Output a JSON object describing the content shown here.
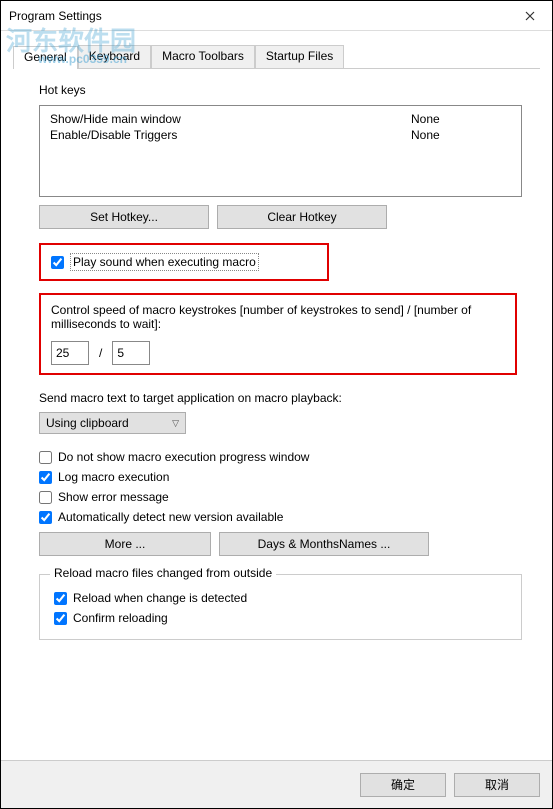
{
  "window": {
    "title": "Program Settings"
  },
  "watermark": {
    "line1": "河东软件园",
    "line2": "www.pc0359.cn"
  },
  "tabs": [
    {
      "label": "General"
    },
    {
      "label": "Keyboard"
    },
    {
      "label": "Macro Toolbars"
    },
    {
      "label": "Startup Files"
    }
  ],
  "hotkeys": {
    "label": "Hot keys",
    "rows": [
      {
        "name": "Show/Hide main window",
        "value": "None"
      },
      {
        "name": "Enable/Disable Triggers",
        "value": "None"
      }
    ],
    "set_btn": "Set Hotkey...",
    "clear_btn": "Clear Hotkey"
  },
  "playsound": {
    "label": "Play sound when executing macro",
    "checked": true
  },
  "speed": {
    "label": "Control speed of macro keystrokes [number of keystrokes to send] / [number of milliseconds to wait]:",
    "keystrokes": "25",
    "sep": "/",
    "ms": "5"
  },
  "sendmode": {
    "label": "Send macro text to target application on macro playback:",
    "value": "Using clipboard"
  },
  "opts": {
    "hide_progress": {
      "label": "Do not show macro execution progress window",
      "checked": false
    },
    "log_exec": {
      "label": "Log macro execution",
      "checked": true
    },
    "show_err": {
      "label": "Show error message",
      "checked": false
    },
    "auto_update": {
      "label": "Automatically detect new version available",
      "checked": true
    }
  },
  "more_btn": "More ...",
  "months_btn": "Days & MonthsNames ...",
  "reload": {
    "legend": "Reload macro files changed from outside",
    "detect": {
      "label": "Reload when change is detected",
      "checked": true
    },
    "confirm": {
      "label": "Confirm reloading",
      "checked": true
    }
  },
  "dialog": {
    "ok": "确定",
    "cancel": "取消"
  }
}
